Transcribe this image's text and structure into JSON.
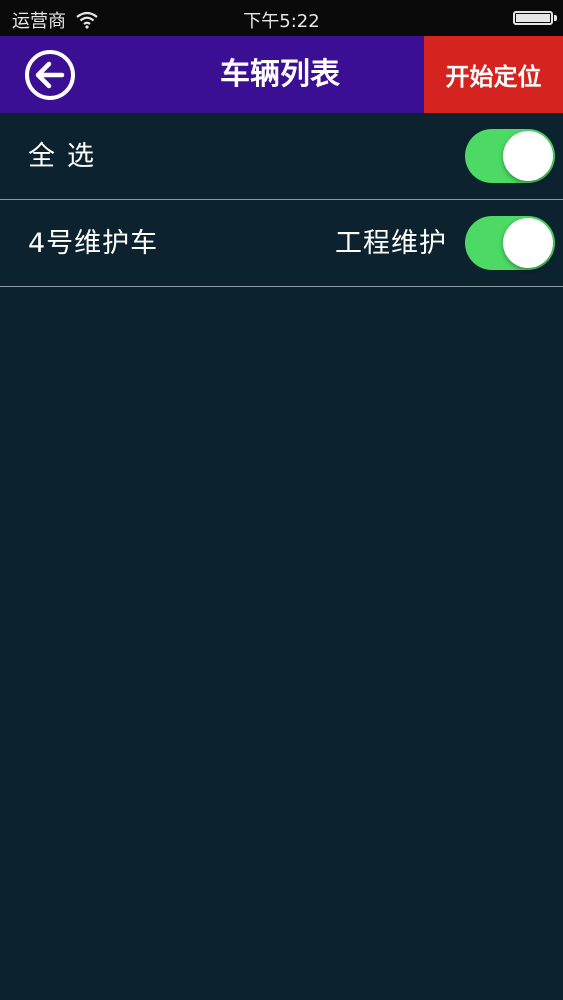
{
  "status_bar": {
    "carrier": "运营商",
    "time": "下午5:22",
    "wifi_icon": "wifi-icon",
    "battery_icon": "battery-icon"
  },
  "nav": {
    "back_icon": "back-arrow-icon",
    "title": "车辆列表",
    "start_button_label": "开始定位"
  },
  "list": {
    "select_all": {
      "label": "全选",
      "on": true
    },
    "vehicles": [
      {
        "name": "4号维护车",
        "type": "工程维护",
        "on": true
      }
    ]
  },
  "colors": {
    "background": "#0c222f",
    "nav_bar": "#3a0f94",
    "start_button": "#d5231f",
    "toggle_on": "#4cd964",
    "divider": "#8a9aa2"
  }
}
